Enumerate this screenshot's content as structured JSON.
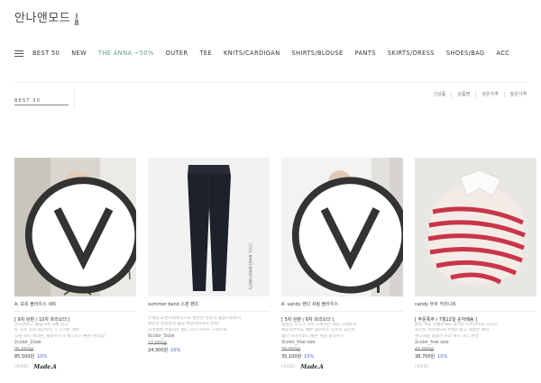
{
  "brand": {
    "name": "안나앤모드"
  },
  "nav": {
    "items": [
      "BEST 50",
      "NEW",
      "THE ANNA ~50%",
      "OUTER",
      "TEE",
      "KNITS/CARDIGAN",
      "SHIRTS/BLOUSE",
      "PANTS",
      "SKIRTS/DRESS",
      "SHOES/BAG",
      "ACC"
    ],
    "accent_color": "#5e9c8f"
  },
  "category": {
    "title": "BEST 50"
  },
  "sort": [
    "신상품",
    "상품명",
    "낮은가격",
    "높은가격"
  ],
  "products": [
    {
      "name": "A. 모유 블라우스 세트",
      "tag": "[ 9차 완판 / 10차 프리오더 ]",
      "desc": [
        "안나앤모드 슬림하게 자체 입고",
        "A. 모유 회사 블라우스 + 스커트 세트",
        "모델 착시 제작된, 블라우스가 체리하기 좋은 여리함!"
      ],
      "colors": "2color_2size",
      "old_price": "95,000원",
      "price": "85,500원",
      "discount": "10%",
      "foot_label": "(프로토)",
      "made_badge": "Made.A"
    },
    {
      "name": "summer band 스판 팬츠",
      "tag": "",
      "desc": [
        "두께감 표준스판제직으로 편안한 핏감의 슬림스판바지",
        "편안한 착용감과 올곧 체형커버까지 완벽!",
        "사계절에 어울리는 밴드 허리 사이즈 구성으로"
      ],
      "colors": "6color_3size",
      "old_price": "27,000원",
      "price": "24,300원",
      "discount": "10%",
      "foot_label": "",
      "made_badge": ""
    },
    {
      "name": "A. sandy 핸디 셔링 블라우스",
      "tag": "[ 5차 완판 / 6차 프리오더 ]",
      "desc": [
        "섬세한 우드가 가득 느껴지는 셔링 디테일과",
        "깨끗하면서도 예쁜 블라우스 단추로 포인트",
        "빛나 이미지보다 밝은 셔링 블라우스"
      ],
      "colors": "3color_free size",
      "old_price": "39,000원",
      "price": "35,100원",
      "discount": "10%",
      "foot_label": "(프로토)",
      "made_badge": "Made.A"
    },
    {
      "name": "candy 부쿠 카라니트",
      "tag": "[ 주문폭주 / 7월22일 순차배송 ]",
      "desc": [
        "밝은 색상 부클소재로 화려한 스트라이프 디자인",
        "포인트 카라넥으로 여성스럽고 개성한 매력",
        "캔디처럼 달콤한 카라 셔츠 코디 완성"
      ],
      "colors": "2color_free size",
      "old_price": "43,000원",
      "price": "38,700원",
      "discount": "10%",
      "foot_label": "(프로토)",
      "made_badge": ""
    }
  ]
}
